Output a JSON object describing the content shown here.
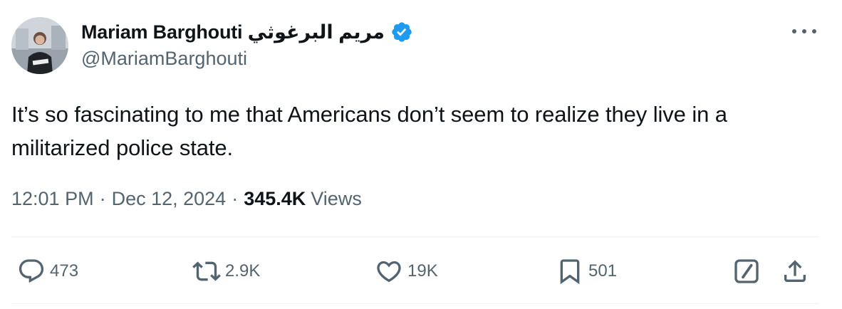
{
  "author": {
    "display_name": "Mariam Barghouti مريم البرغوثي",
    "handle": "@MariamBarghouti",
    "verified": true,
    "verified_color": "#1d9bf0"
  },
  "tweet": {
    "text": "It’s so fascinating to me that Americans don’t seem to realize they live in a militarized police state.",
    "time": "12:01 PM",
    "date": "Dec 12, 2024",
    "separator": "·",
    "views_count": "345.4K",
    "views_label": "Views"
  },
  "actions": {
    "reply": {
      "icon": "reply-icon",
      "count": "473"
    },
    "retweet": {
      "icon": "retweet-icon",
      "count": "2.9K"
    },
    "like": {
      "icon": "heart-icon",
      "count": "19K"
    },
    "bookmark": {
      "icon": "bookmark-icon",
      "count": "501"
    },
    "grok": {
      "icon": "grok-icon"
    },
    "share": {
      "icon": "share-icon"
    }
  },
  "colors": {
    "text_primary": "#0f1419",
    "text_secondary": "#536471",
    "divider": "#eff3f4"
  }
}
